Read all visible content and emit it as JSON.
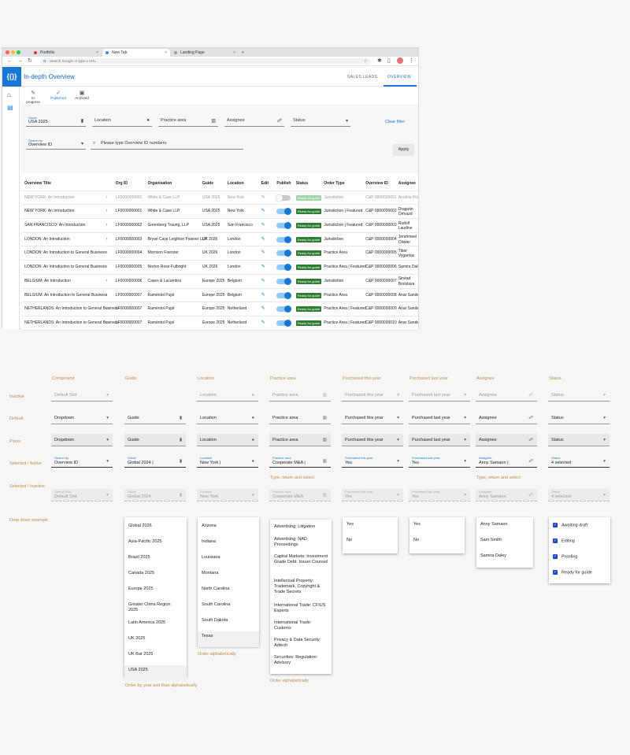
{
  "browser": {
    "tabs": [
      {
        "label": "Portfolio",
        "color": "#e53935"
      },
      {
        "label": "New Tab",
        "color": "#4285f4"
      },
      {
        "label": "Landing Page",
        "color": "#9e9e9e"
      }
    ],
    "address_placeholder": "Search Google or type a URL"
  },
  "app": {
    "logo_text": "{()}",
    "title": "In-depth Overview",
    "top_tabs": [
      "SALES LEADS",
      "OVERVIEW"
    ],
    "status_tabs": [
      "In progress",
      "Published",
      "Archived"
    ],
    "accent_color": "#1976d2"
  },
  "filters": {
    "guide_label": "Guide",
    "guide_value": "USA 2025",
    "location": "Location",
    "practice_area": "Practice area",
    "assignee": "Assignee",
    "status": "Status",
    "clear": "Clear filter",
    "search_by_label": "Search by",
    "search_by_value": "Overview ID",
    "search_placeholder": "Please type Overview ID numbers.",
    "apply": "Apply"
  },
  "table": {
    "headers": [
      "Overview Title",
      "Org ID",
      "Organisation",
      "Guide",
      "Location",
      "Edit",
      "Publish",
      "Status",
      "Order Type",
      "Overview ID",
      "Assignee"
    ],
    "rows": [
      {
        "title": "NEW YORK: An Introduction",
        "org_id": "LF0000000001",
        "org": "White & Case LLP",
        "guide": "USA 2025",
        "location": "New York",
        "publish": false,
        "status": "Ready for guide",
        "order": "Jurisdiction",
        "ov_id": "C&P 0000000001",
        "assignee": "Anahita Prisca",
        "dim": true
      },
      {
        "title": "NEW YORK: An Introduction",
        "org_id": "LF0000000001",
        "org": "White & Case LLP",
        "guide": "USA 2025",
        "location": "New York",
        "publish": true,
        "status": "Ready for guide",
        "order": "Jurisdiction | Featured",
        "ov_id": "C&P 0000000002",
        "assignee": "Dragutin Ormazd",
        "dim": false
      },
      {
        "title": "SAN FRANCISCO: An Introduction",
        "org_id": "LF0000000002",
        "org": "Greenberg Traurig, LLP",
        "guide": "USA 2025",
        "location": "San Francisco",
        "publish": true,
        "status": "Ready for guide",
        "order": "Jurisdiction | Featured",
        "ov_id": "C&P 0000000003",
        "assignee": "Rudolf Laudine",
        "dim": false
      },
      {
        "title": "LONDON: An Introduction",
        "org_id": "LF0000000003",
        "org": "Bryan Cave Leighton Paisner LLP",
        "guide": "UK 2026",
        "location": "London",
        "publish": true,
        "status": "Ready for guide",
        "order": "Jurisdiction",
        "ov_id": "C&P 0000000004",
        "assignee": "Jerahmeel Oliwier",
        "dim": false
      },
      {
        "title": "LONDON: An Introduction to General Business",
        "org_id": "LF0000000004",
        "org": "Morrison Foerster",
        "guide": "UK 2026",
        "location": "London",
        "publish": true,
        "status": "Ready for guide",
        "order": "Practice Area",
        "ov_id": "C&P 0000000005",
        "assignee": "Tibor Vygantas",
        "dim": false
      },
      {
        "title": "LONDON: An Introduction to General Business",
        "org_id": "LF0000000005",
        "org": "Norton Rose Fulbright",
        "guide": "UK 2026",
        "location": "London",
        "publish": true,
        "status": "Ready for guide",
        "order": "Practice Area | Featured",
        "ov_id": "C&P 0000000006",
        "assignee": "Samira Daley",
        "dim": false
      },
      {
        "title": "BELGIUM: An Introduction",
        "org_id": "LF0000000006",
        "org": "Cases & Lacambra",
        "guide": "Europe 2025",
        "location": "Belgium",
        "publish": true,
        "status": "Ready for guide",
        "order": "Jurisdiction",
        "ov_id": "C&P 0000000007",
        "assignee": "Sinéad Borislava",
        "dim": false
      },
      {
        "title": "BELGIUM: An Introduction to General Business",
        "org_id": "LF0000000007",
        "org": "Raméntol Pujol",
        "guide": "Europe 2025",
        "location": "Belgium",
        "publish": true,
        "status": "Ready for guide",
        "order": "Practice Area",
        "ov_id": "C&P 0000000008",
        "assignee": "Anar Sander",
        "dim": false
      },
      {
        "title": "NETHERLANDS: An Introduction to General Business",
        "org_id": "LF0000000007",
        "org": "Raméntol Pujol",
        "guide": "Europe 2025",
        "location": "Netherland",
        "publish": true,
        "status": "Ready for guide",
        "order": "Practice Area | Featured",
        "ov_id": "C&P 0000000009",
        "assignee": "Anar Sander",
        "dim": false
      },
      {
        "title": "NETHERLANDS: An Introduction to General Business",
        "org_id": "LF0000000007",
        "org": "Raméntol Pujol",
        "guide": "Europe 2025",
        "location": "Netherland",
        "publish": true,
        "status": "Ready for guide",
        "order": "Practice Area | Featured",
        "ov_id": "C&P 0000000010",
        "assignee": "Anar Sander",
        "dim": false
      }
    ]
  },
  "spec": {
    "columns": [
      "Component",
      "Guide",
      "Location",
      "Practice area",
      "Purchased this year",
      "Purchased last year",
      "Assignee",
      "Status"
    ],
    "rows": [
      "Inactive",
      "Default",
      "Press",
      "Selected / Active",
      "Selected / Inactive",
      "Drop down example"
    ],
    "inactive": [
      "Default Slot",
      "Location",
      "Practice area",
      "Purchased this year",
      "Purchased last year",
      "Assignee",
      "Status"
    ],
    "default": [
      "Dropdown",
      "Guide",
      "Location",
      "Practice area",
      "Purchased this year",
      "Purchased last year",
      "Assignee",
      "Status"
    ],
    "selected": [
      {
        "label": "Search by",
        "value": "Overview ID"
      },
      {
        "label": "Guide",
        "value": "Global 2024 |"
      },
      {
        "label": "Location",
        "value": "New York |"
      },
      {
        "label": "Practice area",
        "value": "Cooperate M&A |"
      },
      {
        "label": "Purchased this year",
        "value": "Yes"
      },
      {
        "label": "Purchased last year",
        "value": "Yes"
      },
      {
        "label": "Assignee",
        "value": "Anny Samaon |"
      },
      {
        "label": "Status",
        "value": "4 selected"
      }
    ],
    "disabled": [
      {
        "label": "Default Slot",
        "value": "Default Slot"
      },
      {
        "label": "Guide",
        "value": "Global 2024"
      },
      {
        "label": "Location",
        "value": "New York"
      },
      {
        "label": "Practice area",
        "value": "Cooperate M&A"
      },
      {
        "label": "Purchased this year",
        "value": "Yes"
      },
      {
        "label": "Purchased last year",
        "value": "Yes"
      },
      {
        "label": "Assignee",
        "value": "Anny Samaon"
      },
      {
        "label": "Status",
        "value": "4 selected"
      }
    ],
    "hint_type_return": "Type, return and select",
    "guide_options": [
      "Global 2026",
      "Asia-Pacific 2025",
      "Brazil 2025",
      "Canada 2025",
      "Europe 2025",
      "Greater China Region 2025",
      "Latin America 2025",
      "UK 2025",
      "UK Bar 2025",
      "USA 2025"
    ],
    "location_options": [
      "Arizona",
      "Indiana",
      "Louisiana",
      "Montana",
      "North Carolina",
      "South Carolina",
      "South Dakota",
      "Texas"
    ],
    "practice_options": [
      "Advertising: Litigation",
      "Advertising: NAD Proceedings",
      "Capital Markets: Investment Grade Debt: Issuer Counsel",
      "Intellectual Property: Trademark, Copyright & Trade Secrets",
      "International Trade: CFIUS Experts",
      "International Trade: Customs",
      "Privacy & Data Security: Adtech",
      "Securities: Regulation: Advisory"
    ],
    "yes_no": [
      "Yes",
      "No"
    ],
    "assignee_options": [
      "Anny Samaon",
      "Sam Smith",
      "Samira Daley"
    ],
    "status_options": [
      "Awaiting draft",
      "Editing",
      "Proofing",
      "Ready for guide"
    ],
    "note_guide": "Order by year and than alphabetically",
    "note_alpha": "Order alphabetically"
  }
}
